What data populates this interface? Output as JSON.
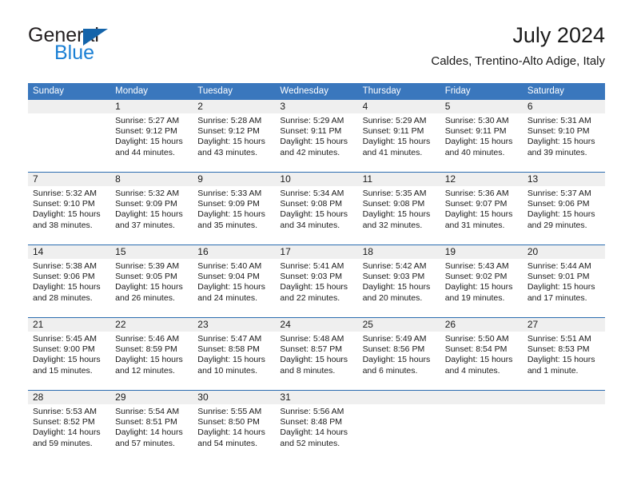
{
  "brand": {
    "name_part1": "General",
    "name_part2": "Blue",
    "triangle_icon": "triangle-icon",
    "colors": {
      "general_text": "#231f20",
      "blue_text": "#1a7fd4",
      "triangle": "#1464aa"
    }
  },
  "header": {
    "title": "July 2024",
    "subtitle": "Caldes, Trentino-Alto Adige, Italy"
  },
  "theme": {
    "header_row_bg": "#3a77bd",
    "header_row_text": "#ffffff",
    "row_divider": "#2b6cb0",
    "daynum_bar_bg": "#efefef",
    "page_bg": "#ffffff",
    "body_text": "#1a1a1a"
  },
  "weekdays": [
    "Sunday",
    "Monday",
    "Tuesday",
    "Wednesday",
    "Thursday",
    "Friday",
    "Saturday"
  ],
  "weeks": [
    [
      {
        "day": "",
        "lines": []
      },
      {
        "day": "1",
        "lines": [
          "Sunrise: 5:27 AM",
          "Sunset: 9:12 PM",
          "Daylight: 15 hours",
          "and 44 minutes."
        ]
      },
      {
        "day": "2",
        "lines": [
          "Sunrise: 5:28 AM",
          "Sunset: 9:12 PM",
          "Daylight: 15 hours",
          "and 43 minutes."
        ]
      },
      {
        "day": "3",
        "lines": [
          "Sunrise: 5:29 AM",
          "Sunset: 9:11 PM",
          "Daylight: 15 hours",
          "and 42 minutes."
        ]
      },
      {
        "day": "4",
        "lines": [
          "Sunrise: 5:29 AM",
          "Sunset: 9:11 PM",
          "Daylight: 15 hours",
          "and 41 minutes."
        ]
      },
      {
        "day": "5",
        "lines": [
          "Sunrise: 5:30 AM",
          "Sunset: 9:11 PM",
          "Daylight: 15 hours",
          "and 40 minutes."
        ]
      },
      {
        "day": "6",
        "lines": [
          "Sunrise: 5:31 AM",
          "Sunset: 9:10 PM",
          "Daylight: 15 hours",
          "and 39 minutes."
        ]
      }
    ],
    [
      {
        "day": "7",
        "lines": [
          "Sunrise: 5:32 AM",
          "Sunset: 9:10 PM",
          "Daylight: 15 hours",
          "and 38 minutes."
        ]
      },
      {
        "day": "8",
        "lines": [
          "Sunrise: 5:32 AM",
          "Sunset: 9:09 PM",
          "Daylight: 15 hours",
          "and 37 minutes."
        ]
      },
      {
        "day": "9",
        "lines": [
          "Sunrise: 5:33 AM",
          "Sunset: 9:09 PM",
          "Daylight: 15 hours",
          "and 35 minutes."
        ]
      },
      {
        "day": "10",
        "lines": [
          "Sunrise: 5:34 AM",
          "Sunset: 9:08 PM",
          "Daylight: 15 hours",
          "and 34 minutes."
        ]
      },
      {
        "day": "11",
        "lines": [
          "Sunrise: 5:35 AM",
          "Sunset: 9:08 PM",
          "Daylight: 15 hours",
          "and 32 minutes."
        ]
      },
      {
        "day": "12",
        "lines": [
          "Sunrise: 5:36 AM",
          "Sunset: 9:07 PM",
          "Daylight: 15 hours",
          "and 31 minutes."
        ]
      },
      {
        "day": "13",
        "lines": [
          "Sunrise: 5:37 AM",
          "Sunset: 9:06 PM",
          "Daylight: 15 hours",
          "and 29 minutes."
        ]
      }
    ],
    [
      {
        "day": "14",
        "lines": [
          "Sunrise: 5:38 AM",
          "Sunset: 9:06 PM",
          "Daylight: 15 hours",
          "and 28 minutes."
        ]
      },
      {
        "day": "15",
        "lines": [
          "Sunrise: 5:39 AM",
          "Sunset: 9:05 PM",
          "Daylight: 15 hours",
          "and 26 minutes."
        ]
      },
      {
        "day": "16",
        "lines": [
          "Sunrise: 5:40 AM",
          "Sunset: 9:04 PM",
          "Daylight: 15 hours",
          "and 24 minutes."
        ]
      },
      {
        "day": "17",
        "lines": [
          "Sunrise: 5:41 AM",
          "Sunset: 9:03 PM",
          "Daylight: 15 hours",
          "and 22 minutes."
        ]
      },
      {
        "day": "18",
        "lines": [
          "Sunrise: 5:42 AM",
          "Sunset: 9:03 PM",
          "Daylight: 15 hours",
          "and 20 minutes."
        ]
      },
      {
        "day": "19",
        "lines": [
          "Sunrise: 5:43 AM",
          "Sunset: 9:02 PM",
          "Daylight: 15 hours",
          "and 19 minutes."
        ]
      },
      {
        "day": "20",
        "lines": [
          "Sunrise: 5:44 AM",
          "Sunset: 9:01 PM",
          "Daylight: 15 hours",
          "and 17 minutes."
        ]
      }
    ],
    [
      {
        "day": "21",
        "lines": [
          "Sunrise: 5:45 AM",
          "Sunset: 9:00 PM",
          "Daylight: 15 hours",
          "and 15 minutes."
        ]
      },
      {
        "day": "22",
        "lines": [
          "Sunrise: 5:46 AM",
          "Sunset: 8:59 PM",
          "Daylight: 15 hours",
          "and 12 minutes."
        ]
      },
      {
        "day": "23",
        "lines": [
          "Sunrise: 5:47 AM",
          "Sunset: 8:58 PM",
          "Daylight: 15 hours",
          "and 10 minutes."
        ]
      },
      {
        "day": "24",
        "lines": [
          "Sunrise: 5:48 AM",
          "Sunset: 8:57 PM",
          "Daylight: 15 hours",
          "and 8 minutes."
        ]
      },
      {
        "day": "25",
        "lines": [
          "Sunrise: 5:49 AM",
          "Sunset: 8:56 PM",
          "Daylight: 15 hours",
          "and 6 minutes."
        ]
      },
      {
        "day": "26",
        "lines": [
          "Sunrise: 5:50 AM",
          "Sunset: 8:54 PM",
          "Daylight: 15 hours",
          "and 4 minutes."
        ]
      },
      {
        "day": "27",
        "lines": [
          "Sunrise: 5:51 AM",
          "Sunset: 8:53 PM",
          "Daylight: 15 hours",
          "and 1 minute."
        ]
      }
    ],
    [
      {
        "day": "28",
        "lines": [
          "Sunrise: 5:53 AM",
          "Sunset: 8:52 PM",
          "Daylight: 14 hours",
          "and 59 minutes."
        ]
      },
      {
        "day": "29",
        "lines": [
          "Sunrise: 5:54 AM",
          "Sunset: 8:51 PM",
          "Daylight: 14 hours",
          "and 57 minutes."
        ]
      },
      {
        "day": "30",
        "lines": [
          "Sunrise: 5:55 AM",
          "Sunset: 8:50 PM",
          "Daylight: 14 hours",
          "and 54 minutes."
        ]
      },
      {
        "day": "31",
        "lines": [
          "Sunrise: 5:56 AM",
          "Sunset: 8:48 PM",
          "Daylight: 14 hours",
          "and 52 minutes."
        ]
      },
      {
        "day": "",
        "lines": []
      },
      {
        "day": "",
        "lines": []
      },
      {
        "day": "",
        "lines": []
      }
    ]
  ]
}
